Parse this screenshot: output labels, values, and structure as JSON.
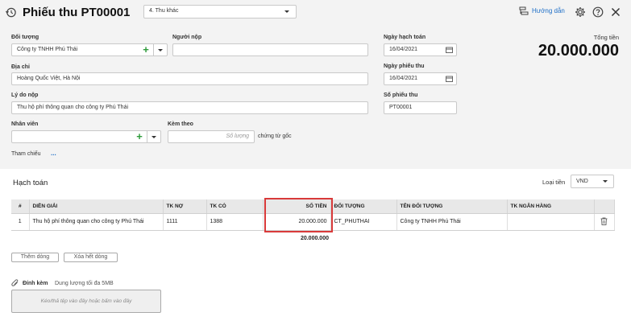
{
  "header": {
    "title": "Phiếu thu PT00001",
    "type_select": "4. Thu khác",
    "help_link": "Hướng dẫn"
  },
  "form": {
    "doi_tuong_label": "Đối tượng",
    "doi_tuong_value": "Công ty TNHH Phú Thái",
    "nguoi_nop_label": "Người nộp",
    "nguoi_nop_value": "",
    "dia_chi_label": "Địa chỉ",
    "dia_chi_value": "Hoàng Quốc Việt, Hà Nội",
    "ly_do_label": "Lý do nộp",
    "ly_do_value": "Thu hộ phí thông quan cho công ty Phú Thái",
    "nhan_vien_label": "Nhân viên",
    "nhan_vien_value": "",
    "kem_theo_label": "Kèm theo",
    "kem_theo_placeholder": "Số lượng",
    "chung_tu_goc": "chứng từ gốc",
    "tham_chieu_label": "Tham chiếu",
    "tham_chieu_link": "..."
  },
  "dates": {
    "ngay_hach_toan_label": "Ngày hạch toán",
    "ngay_hach_toan": "16/04/2021",
    "ngay_phieu_thu_label": "Ngày phiếu thu",
    "ngay_phieu_thu": "16/04/2021",
    "so_phieu_thu_label": "Số phiếu thu",
    "so_phieu_thu": "PT00001"
  },
  "total": {
    "label": "Tổng tiền",
    "value": "20.000.000"
  },
  "accounting": {
    "section_title": "Hạch toán",
    "currency_label": "Loại tiền",
    "currency_value": "VND",
    "columns": [
      "#",
      "DIỄN GIẢI",
      "TK NỢ",
      "TK CÓ",
      "SỐ TIỀN",
      "ĐỐI TƯỢNG",
      "TÊN ĐỐI TƯỢNG",
      "TK NGÂN HÀNG"
    ],
    "rows": [
      {
        "no": "1",
        "dien_giai": "Thu hộ phí thông quan cho công ty Phú Thái",
        "tk_no": "1111",
        "tk_co": "1388",
        "so_tien": "20.000.000",
        "doi_tuong": "CT_PHUTHAI",
        "ten_doi_tuong": "Công ty TNHH Phú Thái",
        "tk_ngan_hang": ""
      }
    ],
    "sum_so_tien": "20.000.000",
    "add_row_button": "Thêm dòng",
    "clear_rows_button": "Xóa hết dòng"
  },
  "attachment": {
    "label": "Đính kèm",
    "limit_text": "Dung lượng tối đa 5MB",
    "drop_text": "Kéo/thả tệp vào đây hoặc bấm vào đây"
  },
  "colors": {
    "highlight": "#d93a3a",
    "add_icon": "#2e9b3a",
    "link": "#1d6ec7"
  }
}
